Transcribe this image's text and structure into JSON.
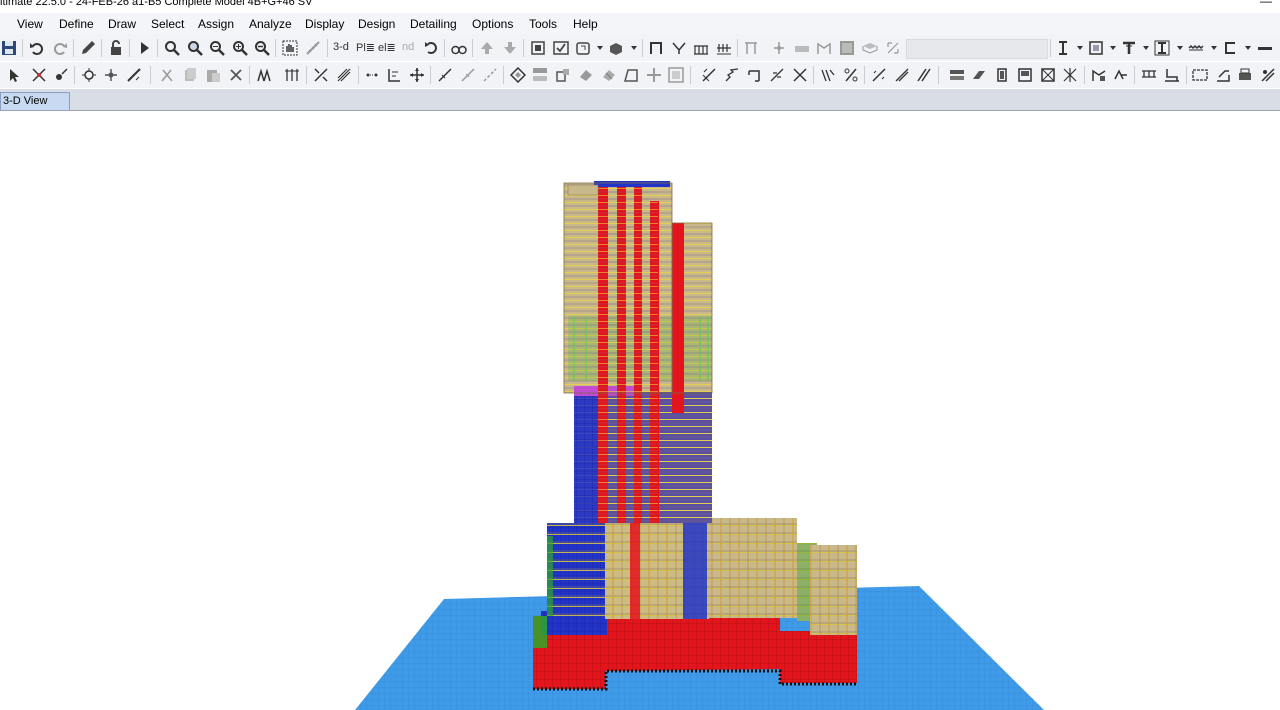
{
  "window": {
    "title": "ltimate 22.5.0 - 24-FEB-26 a1-B5 Complete Model 4B+G+46 SV",
    "minimize_glyph": "—"
  },
  "menu": {
    "items": [
      "View",
      "Define",
      "Draw",
      "Select",
      "Assign",
      "Analyze",
      "Display",
      "Design",
      "Detailing",
      "Options",
      "Tools",
      "Help"
    ]
  },
  "toolbar": {
    "view_3d_label": "3-d",
    "plan_label": "Pl≣",
    "elev_label": "el≣",
    "nd_label": "nd"
  },
  "tabs": {
    "active_label": "3-D View"
  },
  "colors": {
    "ground_plane": "#3f9be8",
    "wall_red": "#e3141b",
    "wall_blue": "#2234c8",
    "beam_yellow": "#d6c24a",
    "slab_tan": "#c9b98a",
    "column_green": "#2fa82a",
    "highlight_magenta": "#c34bd1"
  }
}
